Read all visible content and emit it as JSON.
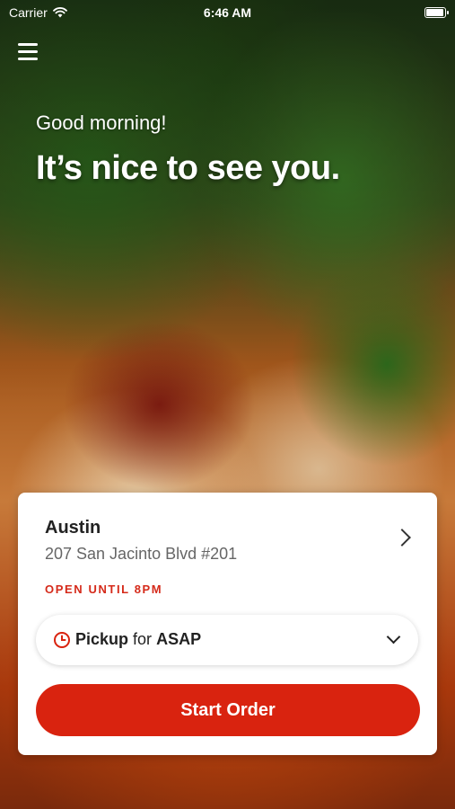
{
  "status_bar": {
    "carrier": "Carrier",
    "time": "6:46 AM"
  },
  "header": {
    "greeting": "Good morning!",
    "headline": "It’s nice to see you."
  },
  "location": {
    "name": "Austin",
    "address": "207 San Jacinto Blvd #201",
    "hours": "OPEN UNTIL 8PM"
  },
  "order_mode": {
    "mode": "Pickup",
    "connector": "for",
    "time": "ASAP"
  },
  "actions": {
    "start_order": "Start Order"
  },
  "colors": {
    "accent": "#d9230f",
    "status_text": "#d52a1a"
  },
  "icons": {
    "menu": "hamburger-menu-icon",
    "wifi": "wifi-icon",
    "battery": "battery-icon",
    "location_chevron": "chevron-right-icon",
    "clock": "clock-icon",
    "dropdown": "chevron-down-icon"
  }
}
